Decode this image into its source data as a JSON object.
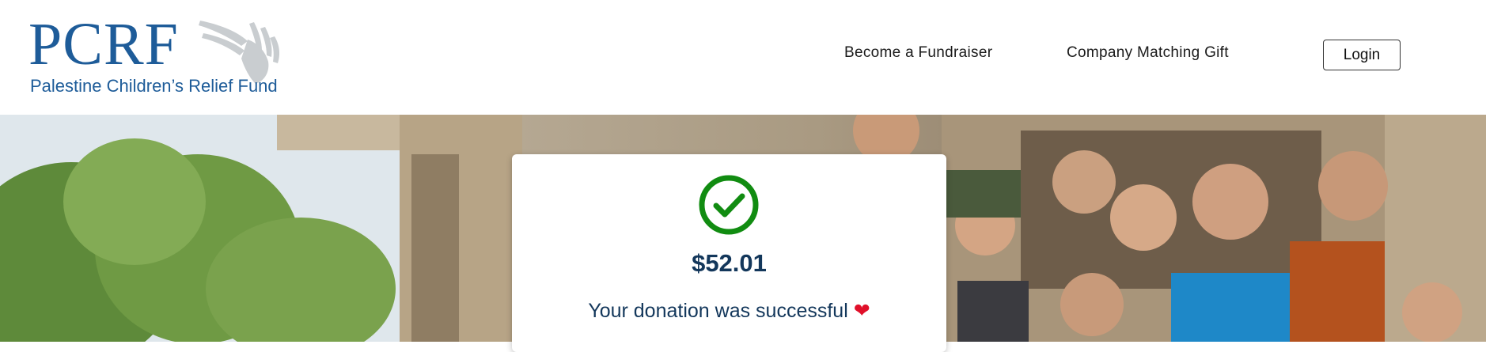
{
  "brand": {
    "wordmark": "PCRF",
    "name": "Palestine Children’s Relief Fund",
    "color": "#1e5c99"
  },
  "nav": {
    "fundraiser": "Become a Fundraiser",
    "matching": "Company Matching Gift",
    "login": "Login"
  },
  "donation": {
    "amount": "$52.01",
    "message": "Your donation was successful",
    "heart": "❤",
    "status_icon": "check-circle-icon",
    "status_color": "#118c11"
  }
}
